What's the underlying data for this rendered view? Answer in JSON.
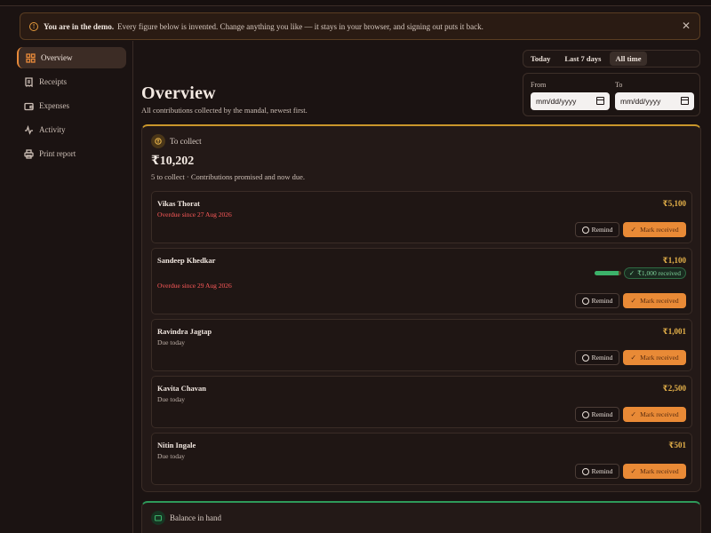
{
  "banner": {
    "bold": "You are in the demo.",
    "text": "Every figure below is invented. Change anything you like — it stays in your browser, and signing out puts it back."
  },
  "sidebar": {
    "items": [
      {
        "label": "Overview",
        "icon": "grid-icon",
        "active": true
      },
      {
        "label": "Receipts",
        "icon": "receipt-icon",
        "active": false
      },
      {
        "label": "Expenses",
        "icon": "wallet-icon",
        "active": false
      },
      {
        "label": "Activity",
        "icon": "activity-icon",
        "active": false
      },
      {
        "label": "Print report",
        "icon": "printer-icon",
        "active": false
      }
    ]
  },
  "filters": {
    "ranges": [
      "Today",
      "Last 7 days",
      "All time"
    ],
    "selected": "All time",
    "from_label": "From",
    "to_label": "To",
    "from_value": "mm/dd/yyyy",
    "to_value": "mm/dd/yyyy"
  },
  "page": {
    "title": "Overview",
    "subtitle": "All contributions collected by the mandal, newest first."
  },
  "collect": {
    "heading": "To collect",
    "amount": "₹10,202",
    "summary": "5 to collect · Contributions promised and now due.",
    "remind_label": "Remind",
    "mark_label": "Mark received",
    "rows": [
      {
        "name": "Vikas Thorat",
        "amount": "₹5,100",
        "due": "Overdue since 27 Aug 2026",
        "overdue": true
      },
      {
        "name": "Sandeep Khedkar",
        "amount": "₹1,100",
        "due": "Overdue since 29 Aug 2026",
        "overdue": true,
        "paid_badge": "₹1,000 received",
        "paid_fraction": 0.91
      },
      {
        "name": "Ravindra Jagtap",
        "amount": "₹1,001",
        "due": "Due today",
        "overdue": false
      },
      {
        "name": "Kavita Chavan",
        "amount": "₹2,500",
        "due": "Due today",
        "overdue": false
      },
      {
        "name": "Nitin Ingale",
        "amount": "₹501",
        "due": "Due today",
        "overdue": false
      }
    ]
  },
  "balance": {
    "heading": "Balance in hand"
  },
  "colors": {
    "accent": "#e98a36",
    "amount": "#e6b24a",
    "overdue": "#ff5a5a",
    "success": "#3cb26a"
  }
}
